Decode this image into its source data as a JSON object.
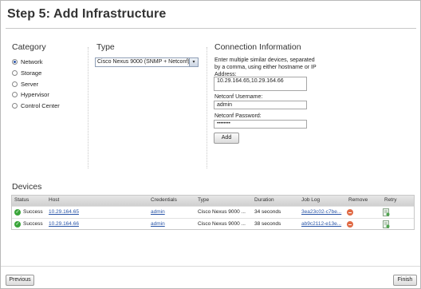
{
  "page": {
    "title": "Step 5: Add Infrastructure"
  },
  "category": {
    "title": "Category",
    "options": [
      {
        "label": "Network",
        "selected": true
      },
      {
        "label": "Storage",
        "selected": false
      },
      {
        "label": "Server",
        "selected": false
      },
      {
        "label": "Hypervisor",
        "selected": false
      },
      {
        "label": "Control Center",
        "selected": false
      }
    ]
  },
  "type": {
    "title": "Type",
    "selected_value": "Cisco Nexus 9000 (SNMP + Netconf)"
  },
  "connection": {
    "title": "Connection Information",
    "help_text": "Enter multiple similar devices, separated by a comma, using either hostname or IP Address:",
    "hosts_value": "10.29.164.65,10.29.164.66",
    "username_label": "Netconf Username:",
    "username_value": "admin",
    "password_label": "Netconf Password:",
    "password_value": "••••••••",
    "add_label": "Add"
  },
  "devices": {
    "title": "Devices",
    "columns": [
      "Status",
      "Host",
      "Credentials",
      "Type",
      "Duration",
      "Job Log",
      "Remove",
      "Retry"
    ],
    "rows": [
      {
        "status": "Success",
        "host": "10.29.164.65",
        "credentials": "admin",
        "type": "Cisco Nexus 9000 ...",
        "duration": "34 seconds",
        "job_log": "3ea23c02-c7be..."
      },
      {
        "status": "Success",
        "host": "10.29.164.66",
        "credentials": "admin",
        "type": "Cisco Nexus 9000 ...",
        "duration": "38 seconds",
        "job_log": "ab9c2112-e13e..."
      }
    ]
  },
  "footer": {
    "previous_label": "Previous",
    "finish_label": "Finish"
  },
  "colors": {
    "link": "#2a56a8",
    "success": "#3aa53a",
    "remove": "#e06a45",
    "radio_selected": "#2b55a8"
  },
  "icons": {
    "success": "check-circle-icon",
    "remove": "minus-circle-icon",
    "retry": "retry-document-icon",
    "dropdown": "chevron-down-icon"
  }
}
